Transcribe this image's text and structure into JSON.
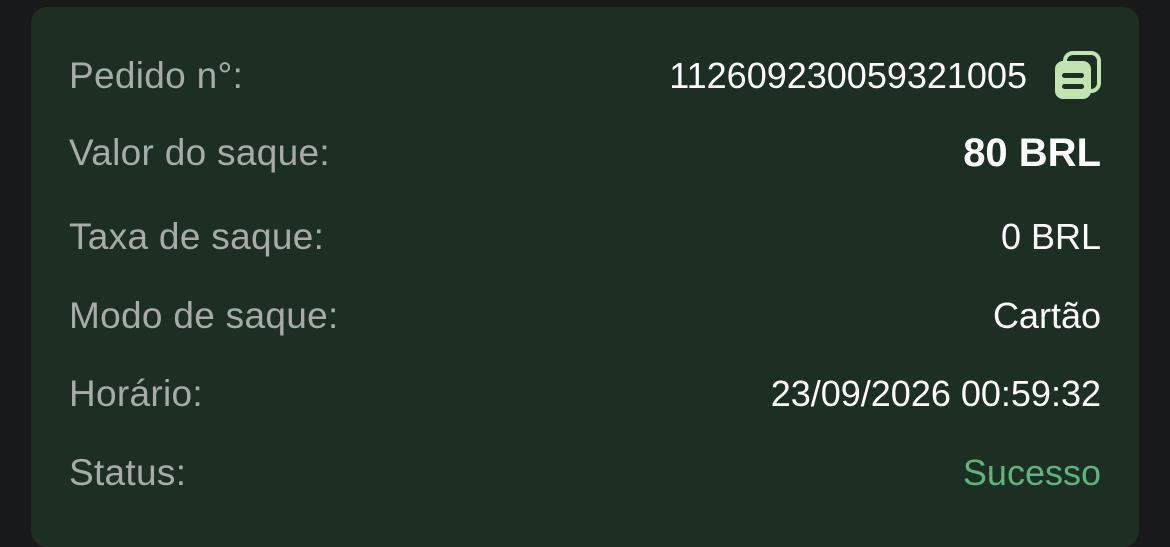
{
  "colors": {
    "background": "#17191b",
    "card": "#1d2f23",
    "label": "#a7aca8",
    "value": "#ffffff",
    "success": "#5fb37c",
    "copy_icon": "#c4e3b3"
  },
  "order": {
    "label": "Pedido n°:",
    "value": "112609230059321005",
    "copy_icon": "copy-icon"
  },
  "amount": {
    "label": "Valor do saque:",
    "value": "80 BRL"
  },
  "fee": {
    "label": "Taxa de saque:",
    "value": "0 BRL"
  },
  "mode": {
    "label": "Modo de saque:",
    "value": "Cartão"
  },
  "time": {
    "label": "Horário:",
    "value": "23/09/2026 00:59:32"
  },
  "status": {
    "label": "Status:",
    "value": "Sucesso"
  }
}
